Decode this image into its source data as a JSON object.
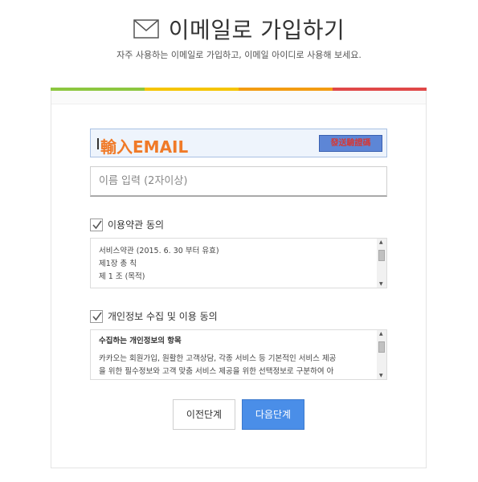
{
  "header": {
    "title": "이메일로 가입하기",
    "subtitle": "자주 사용하는 이메일로 가입하고, 이메일 아이디로 사용해 보세요."
  },
  "colorbar": [
    "#8cc63f",
    "#f5c400",
    "#f39c12",
    "#e04848"
  ],
  "email": {
    "watermark": "輸入EMAIL",
    "verify_label": "發送驗證碼"
  },
  "name_field": {
    "placeholder": "이름 입력 (2자이상)"
  },
  "terms": {
    "label": "이용약관 동의",
    "checked": true,
    "lines": [
      "서비스약관 (2015. 6. 30 부터 유효)",
      "제1장 총 칙",
      "제 1 조 (목적)"
    ]
  },
  "privacy": {
    "label": "개인정보 수집 및 이용 동의",
    "checked": true,
    "heading": "수집하는 개인정보의 항목",
    "lines": [
      "카카오는 회원가입, 원활한 고객상담, 각종 서비스 등 기본적인 서비스 제공",
      "을 위한 필수정보와 고객 맞춤 서비스 제공을 위한 선택정보로 구분하여 아"
    ]
  },
  "buttons": {
    "prev": "이전단계",
    "next": "다음단계"
  },
  "colors": {
    "primary": "#4a8ee8",
    "watermark": "#f07a28"
  }
}
